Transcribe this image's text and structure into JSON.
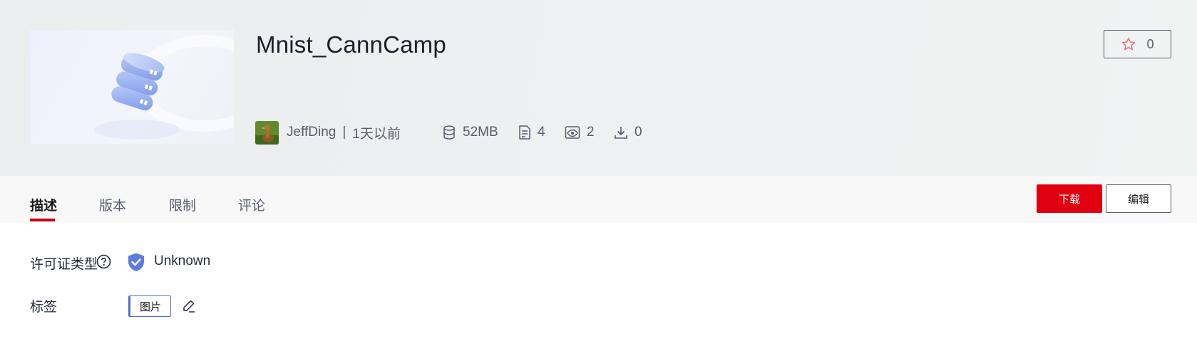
{
  "dataset": {
    "title": "Mnist_CannCamp",
    "author": "JeffDing",
    "separator": "|",
    "updated": "1天以前",
    "size": "52MB",
    "files": "4",
    "views": "2",
    "downloads": "0",
    "stars": "0"
  },
  "tabs": [
    "描述",
    "版本",
    "限制",
    "评论"
  ],
  "actions": {
    "download_label": "下载",
    "edit_label": "编辑"
  },
  "details": {
    "license_label": "许可证类型",
    "license_value": "Unknown",
    "tags_label": "标签",
    "tags": [
      "图片"
    ]
  },
  "colors": {
    "accent": "#c7000b",
    "download_button": "#e00010",
    "tag_border": "#526ecc",
    "shield": "#5e7ce0"
  },
  "icons": [
    "database-cover-icon",
    "star-icon",
    "database-icon",
    "file-icon",
    "eye-icon",
    "download-icon",
    "help-icon",
    "shield-check-icon",
    "pencil-icon"
  ]
}
